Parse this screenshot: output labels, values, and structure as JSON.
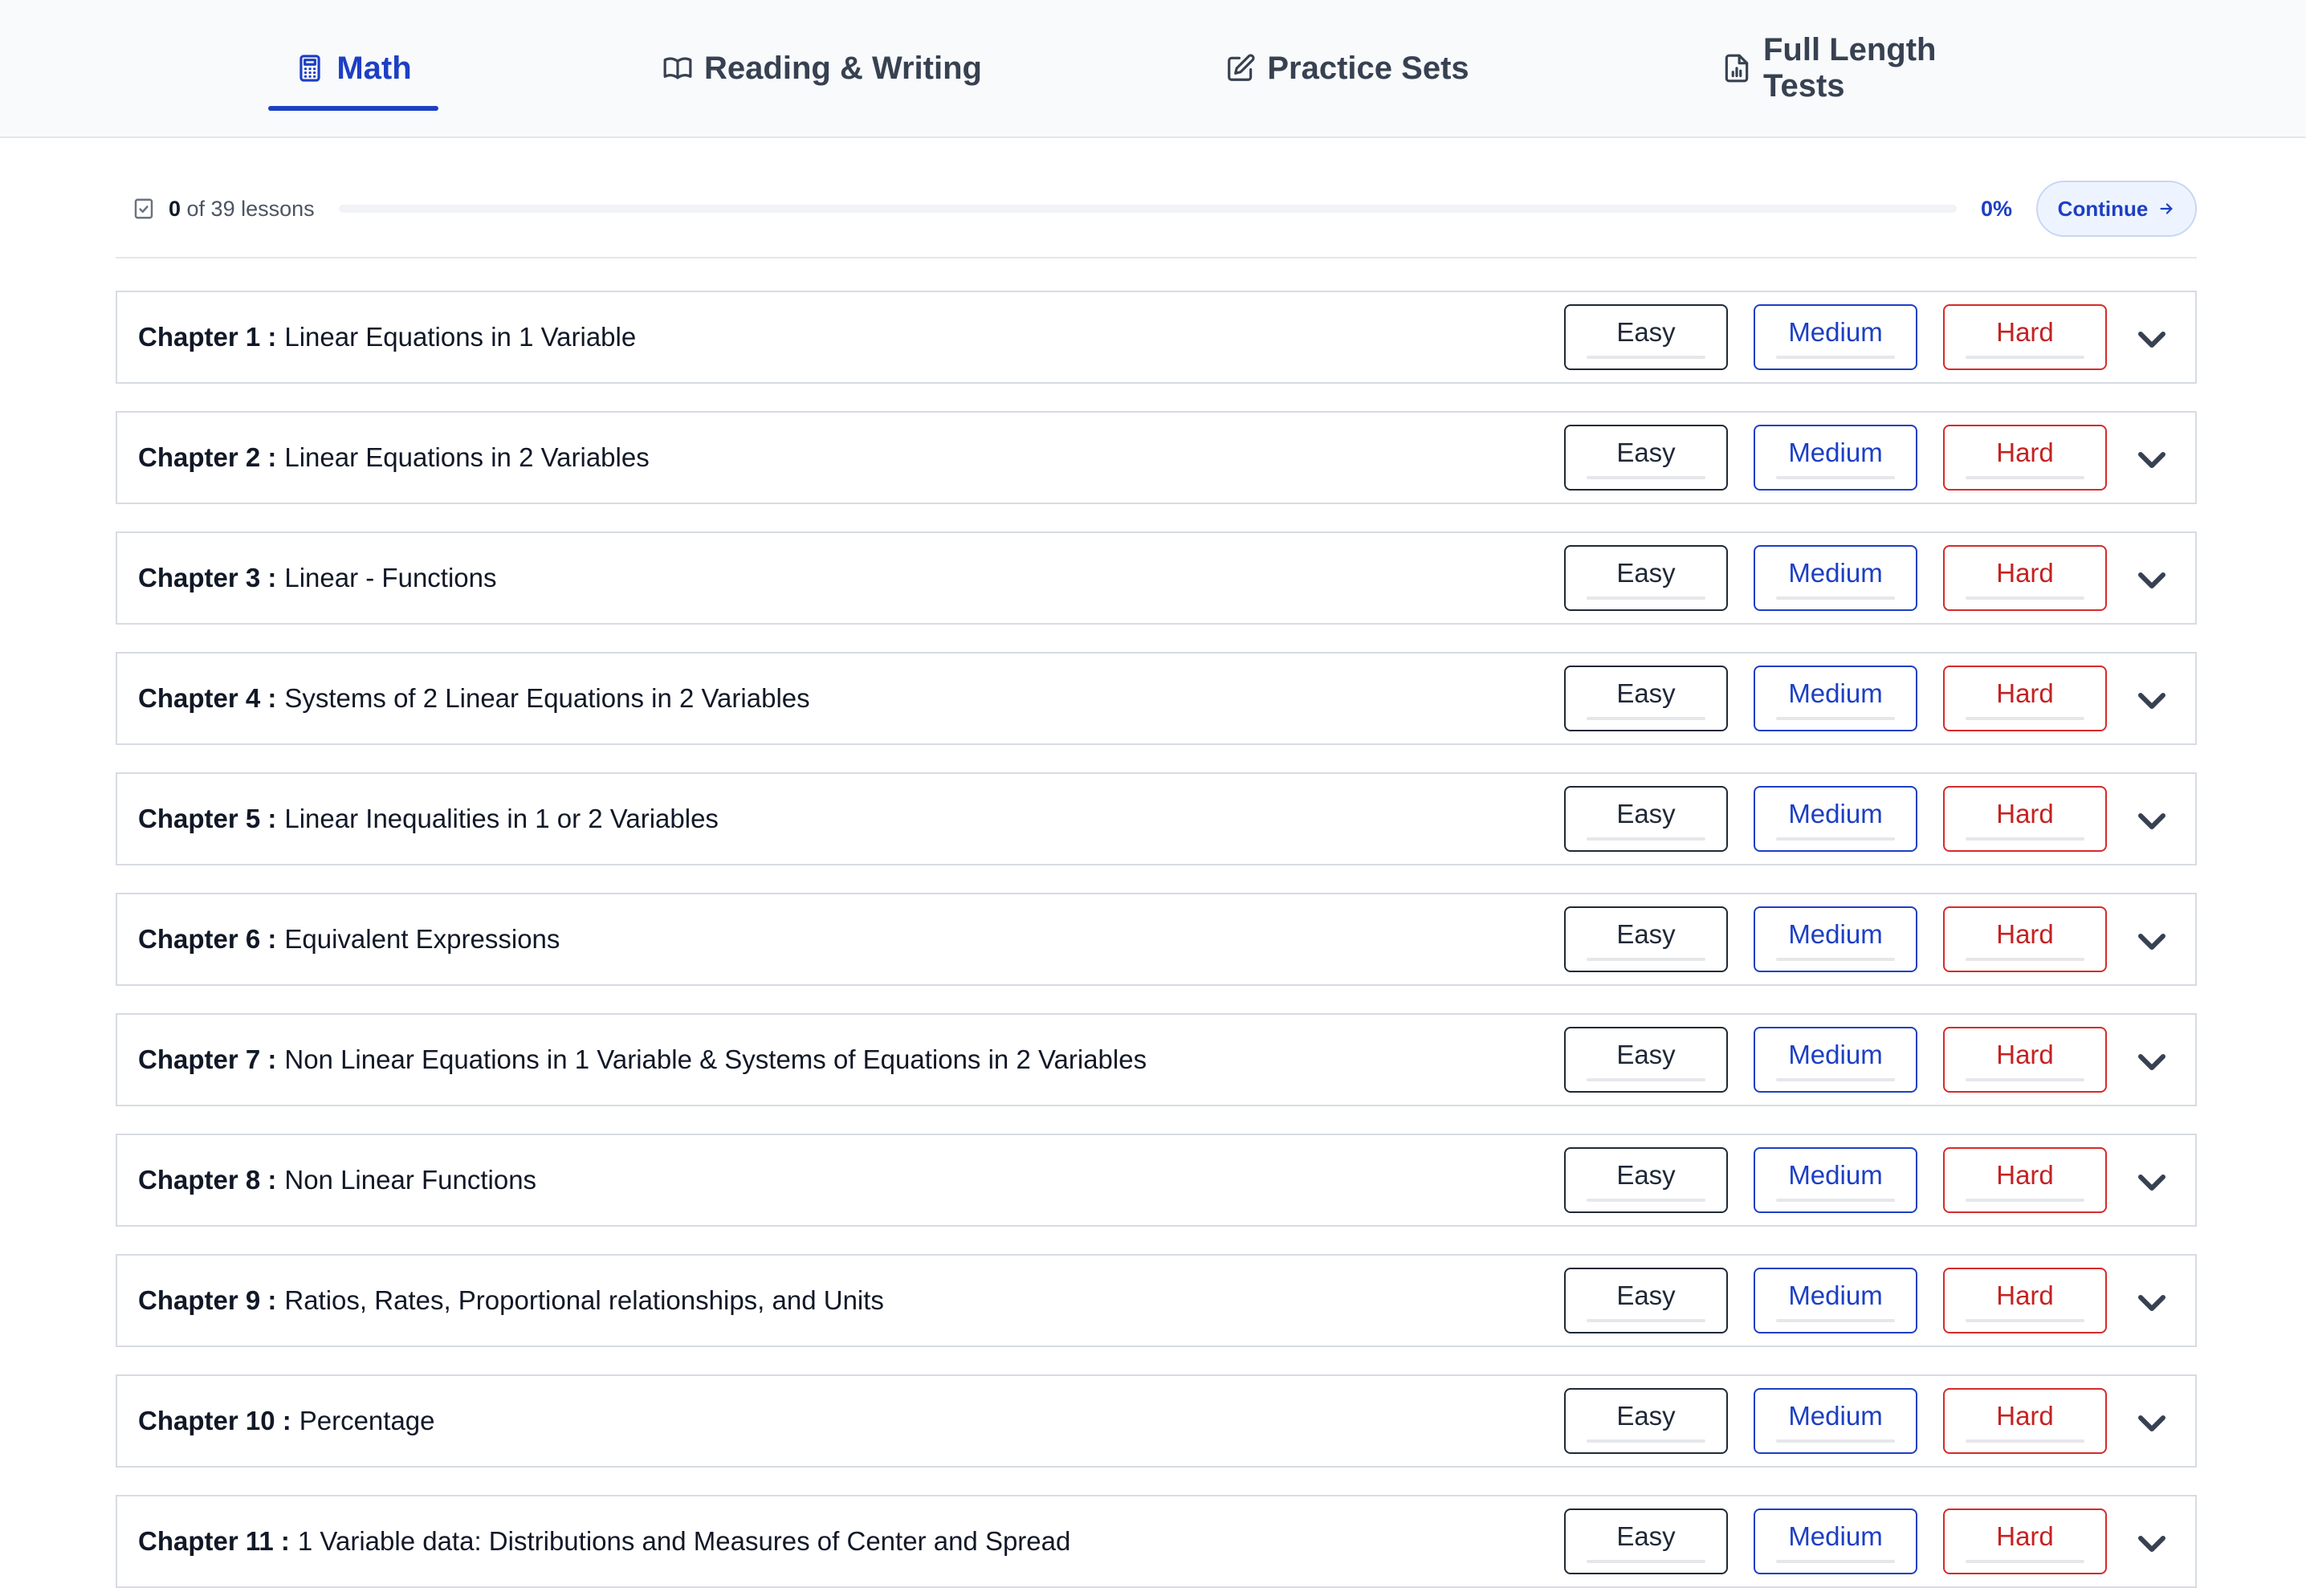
{
  "tabs": [
    {
      "label": "Math",
      "icon": "calculator-icon",
      "active": true
    },
    {
      "label": "Reading & Writing",
      "icon": "book-open-icon",
      "active": false
    },
    {
      "label": "Practice Sets",
      "icon": "pencil-square-icon",
      "active": false
    },
    {
      "label": "Full Length Tests",
      "icon": "file-chart-icon",
      "active": false
    }
  ],
  "progress": {
    "completed": "0",
    "rest": " of 39 lessons",
    "percent_label": "0%",
    "fraction": 0,
    "continue_label": "Continue"
  },
  "difficulty_labels": {
    "easy": "Easy",
    "medium": "Medium",
    "hard": "Hard"
  },
  "chapters": [
    {
      "num": "Chapter 1 :",
      "title": "Linear Equations in 1 Variable"
    },
    {
      "num": "Chapter 2 :",
      "title": "Linear Equations in 2 Variables"
    },
    {
      "num": "Chapter 3 :",
      "title": "Linear - Functions"
    },
    {
      "num": "Chapter 4 :",
      "title": "Systems of 2 Linear Equations in 2 Variables"
    },
    {
      "num": "Chapter 5 :",
      "title": "Linear Inequalities in 1 or 2 Variables"
    },
    {
      "num": "Chapter 6 :",
      "title": "Equivalent Expressions"
    },
    {
      "num": "Chapter 7 :",
      "title": "Non Linear Equations in 1 Variable & Systems of Equations in 2 Variables"
    },
    {
      "num": "Chapter 8 :",
      "title": "Non Linear Functions"
    },
    {
      "num": "Chapter 9 :",
      "title": "Ratios, Rates, Proportional relationships, and Units"
    },
    {
      "num": "Chapter 10 :",
      "title": "Percentage"
    },
    {
      "num": "Chapter 11 :",
      "title": "1 Variable data: Distributions and Measures of Center and Spread"
    }
  ],
  "colors": {
    "accent": "#1d3fc4",
    "hard": "#d62b2b",
    "easy": "#1f2937"
  }
}
